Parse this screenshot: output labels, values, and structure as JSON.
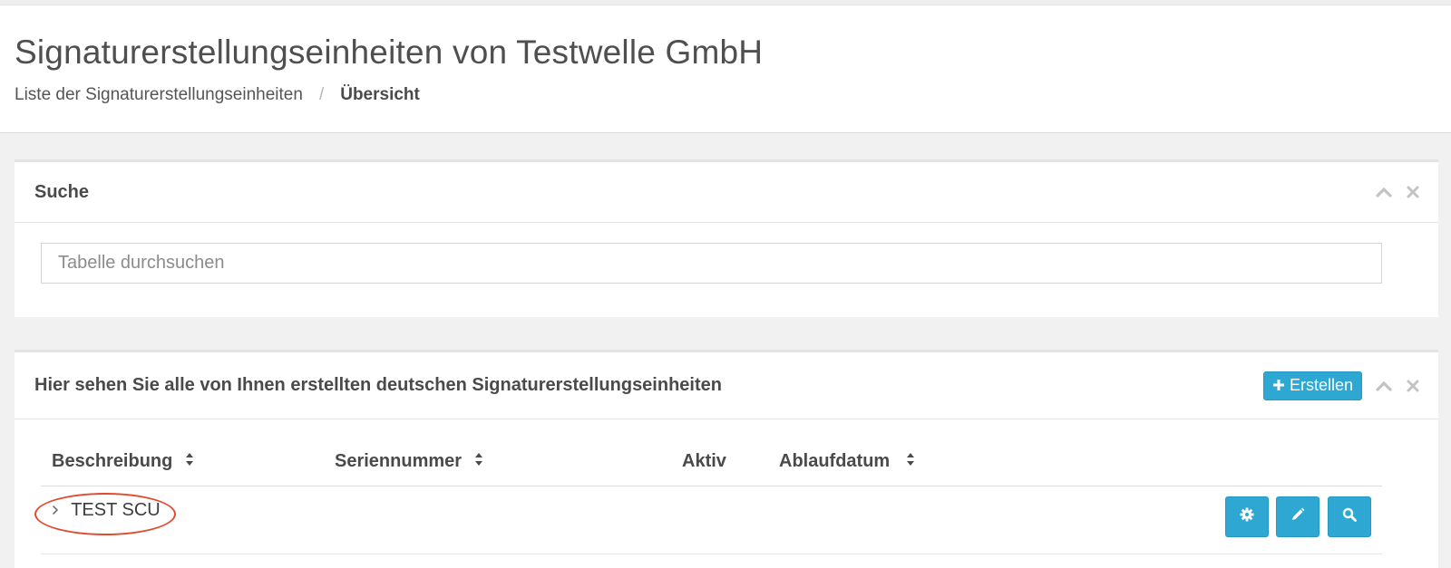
{
  "header": {
    "title": "Signaturerstellungseinheiten von Testwelle GmbH",
    "breadcrumb": {
      "parent": "Liste der Signaturerstellungseinheiten",
      "separator": "/",
      "current": "Übersicht"
    }
  },
  "search_panel": {
    "title": "Suche",
    "input": {
      "placeholder": "Tabelle durchsuchen",
      "value": ""
    },
    "tools": [
      "chevron-up-icon",
      "close-icon"
    ]
  },
  "list_panel": {
    "title": "Hier sehen Sie alle von Ihnen erstellten deutschen Signaturerstellungseinheiten",
    "create_label": "Erstellen",
    "tools": [
      "chevron-up-icon",
      "close-icon"
    ],
    "columns": [
      "Beschreibung",
      "Seriennummer",
      "Aktiv",
      "Ablaufdatum"
    ],
    "rows": [
      {
        "beschreibung": "TEST SCU",
        "seriennummer": "",
        "aktiv": "",
        "ablaufdatum": "",
        "actions": [
          "gear-icon",
          "pencil-icon",
          "search-icon"
        ]
      }
    ]
  },
  "colors": {
    "accent": "#2ea7d2",
    "highlight": "#e04b2e",
    "background": "#f1f1f1"
  }
}
